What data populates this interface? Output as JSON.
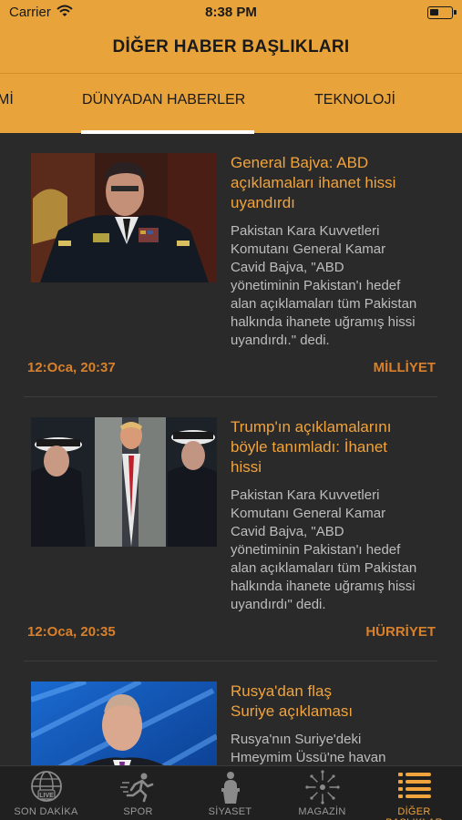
{
  "status_bar": {
    "carrier": "Carrier",
    "time": "8:38 PM"
  },
  "header": {
    "title": "DİĞER HABER BAŞLIKLARI"
  },
  "tabs": [
    {
      "label": "Mİ",
      "active": false
    },
    {
      "label": "DÜNYADAN HABERLER",
      "active": true
    },
    {
      "label": "TEKNOLOJİ",
      "active": false
    }
  ],
  "articles": [
    {
      "headline_lines": [
        "General Bajva: ABD",
        "açıklamaları ihanet hissi",
        "uyandırdı"
      ],
      "summary_lines": [
        "Pakistan Kara Kuvvetleri",
        "Komutanı General Kamar",
        "Cavid  Bajva, \"ABD",
        "yönetiminin Pakistan'ı hedef",
        "alan açıklamaları tüm Pakistan",
        "halkında  ihanete uğramış hissi",
        "uyandırdı.\" dedi."
      ],
      "time": "12:Oca, 20:37",
      "source": "MİLLİYET"
    },
    {
      "headline_lines": [
        "Trump'ın açıklamalarını",
        "böyle tanımladı: İhanet",
        "hissi"
      ],
      "summary_lines": [
        "Pakistan Kara Kuvvetleri",
        "Komutanı General Kamar",
        "Cavid Bajva, \"ABD",
        "yönetiminin Pakistan'ı hedef",
        "alan açıklamaları tüm Pakistan",
        "halkında ihanete uğramış hissi",
        "uyandırdı\" dedi."
      ],
      "time": "12:Oca, 20:35",
      "source": "HÜRRİYET"
    },
    {
      "headline_lines": [
        "Rusya'dan flaş",
        "Suriye açıklaması"
      ],
      "summary_lines": [
        "Rusya'nın Suriye'deki",
        "Hmeymim Üssü'ne havan"
      ],
      "time": "",
      "source": ""
    }
  ],
  "tab_bar": {
    "items": [
      {
        "label": "SON DAKİKA",
        "icon": "globe-live-icon",
        "badge": "LIVE",
        "active": false
      },
      {
        "label": "SPOR",
        "icon": "runner-icon",
        "active": false
      },
      {
        "label": "SİYASET",
        "icon": "podium-speaker-icon",
        "active": false
      },
      {
        "label": "MAGAZİN",
        "icon": "sparkle-icon",
        "active": false
      },
      {
        "label": "DİĞER BAŞLIKLAR",
        "icon": "list-icon",
        "active": true
      }
    ]
  },
  "colors": {
    "accent": "#e8a33a",
    "headline": "#f1a33c",
    "meta": "#d9802a",
    "background": "#2a2a2a"
  }
}
